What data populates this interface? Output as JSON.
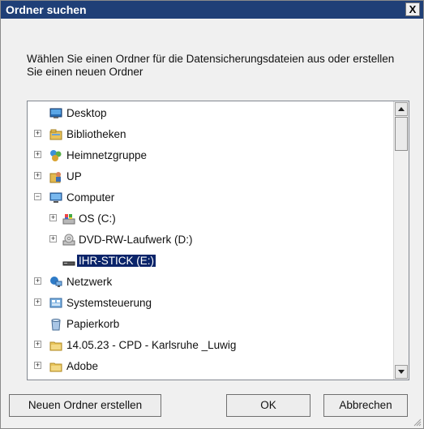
{
  "dialog": {
    "title": "Ordner suchen",
    "close_label": "X",
    "description": "Wählen Sie einen Ordner für die Datensicherungsdateien aus oder erstellen Sie einen neuen Ordner"
  },
  "tree": {
    "items": [
      {
        "label": "Desktop",
        "icon": "desktop-icon",
        "expander": "none",
        "selected": false
      },
      {
        "label": "Bibliotheken",
        "icon": "libraries-icon",
        "expander": "plus",
        "selected": false
      },
      {
        "label": "Heimnetzgruppe",
        "icon": "homegroup-icon",
        "expander": "plus",
        "selected": false
      },
      {
        "label": "UP",
        "icon": "user-folder-icon",
        "expander": "plus",
        "selected": false
      },
      {
        "label": "Computer",
        "icon": "computer-icon",
        "expander": "minus",
        "selected": false
      },
      {
        "label": "OS (C:)",
        "icon": "drive-c-icon",
        "expander": "plus",
        "selected": false
      },
      {
        "label": "DVD-RW-Laufwerk (D:)",
        "icon": "dvd-drive-icon",
        "expander": "plus",
        "selected": false
      },
      {
        "label": "IHR-STICK (E:)",
        "icon": "usb-drive-icon",
        "expander": "none",
        "selected": true
      },
      {
        "label": "Netzwerk",
        "icon": "network-icon",
        "expander": "plus",
        "selected": false
      },
      {
        "label": "Systemsteuerung",
        "icon": "control-panel-icon",
        "expander": "plus",
        "selected": false
      },
      {
        "label": "Papierkorb",
        "icon": "recycle-bin-icon",
        "expander": "none",
        "selected": false
      },
      {
        "label": "14.05.23 - CPD - Karlsruhe _Luwig",
        "icon": "folder-icon",
        "expander": "plus",
        "selected": false
      },
      {
        "label": "Adobe",
        "icon": "folder-icon",
        "expander": "plus",
        "selected": false
      }
    ]
  },
  "buttons": {
    "new_folder": "Neuen Ordner erstellen",
    "ok": "OK",
    "cancel": "Abbrechen"
  },
  "colors": {
    "titlebar": "#1f3f77",
    "selection": "#0a246a",
    "background": "#f0f0f0"
  }
}
